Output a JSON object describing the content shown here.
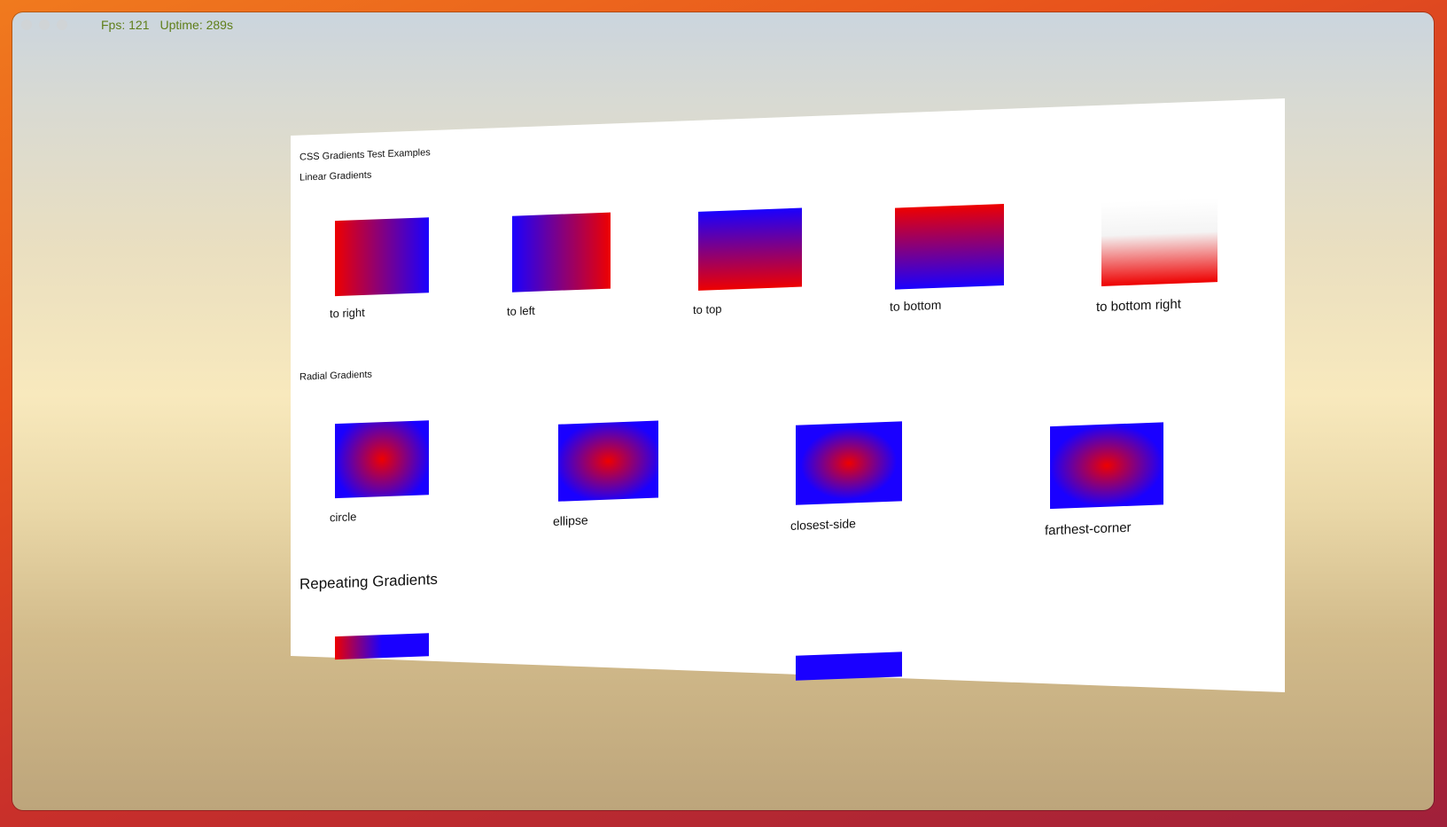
{
  "hud": {
    "fps": "Fps: 121",
    "uptime": "Uptime: 289s"
  },
  "page": {
    "title": "CSS Gradients Test Examples",
    "linear_heading": "Linear Gradients",
    "linear_items": [
      {
        "label": "to right",
        "from": "#ee0000",
        "to": "#1a00ff"
      },
      {
        "label": "to left",
        "from": "#1a00ff",
        "to": "#ee0000"
      },
      {
        "label": "to top",
        "from": "#1a00ff",
        "to": "#ee0000"
      },
      {
        "label": "to bottom",
        "from": "#ee0000",
        "to": "#1a00ff"
      },
      {
        "label": "to bottom right",
        "from": "#ffffff",
        "to": "#ee0000"
      }
    ],
    "radial_heading": "Radial Gradients",
    "radial_items": [
      {
        "label": "circle"
      },
      {
        "label": "ellipse"
      },
      {
        "label": "closest-side"
      },
      {
        "label": "farthest-corner"
      }
    ],
    "repeating_heading": "Repeating Gradients"
  },
  "colors": {
    "red": "#ee0000",
    "blue": "#1a00ff",
    "hud_text": "#5f7f1a"
  }
}
